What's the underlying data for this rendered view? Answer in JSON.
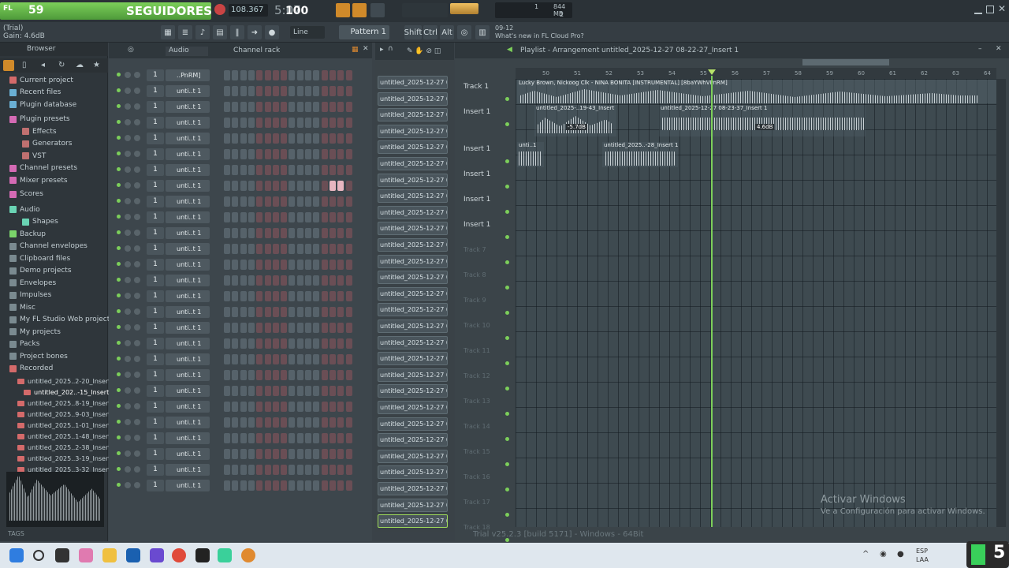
{
  "overlay": {
    "count": "59",
    "label": "SEGUIDORES"
  },
  "transport": {
    "tempo": "108.367",
    "pattern_num": "100",
    "counter": "5:07"
  },
  "cpu": {
    "memory": "844 MB",
    "voices": "1",
    "cpu_n": "2"
  },
  "hint": {
    "date": "09-12",
    "text": "What's new in FL Cloud Pro?"
  },
  "app": {
    "trial": "(Trial)",
    "gain": "Gain: 4.6dB",
    "snap_mode": "Line",
    "pattern": "Pattern 1",
    "mode_shift": "Shift",
    "mode_ctrl": "Ctrl",
    "mode_alt": "Alt"
  },
  "browser": {
    "title": "Browser",
    "items": [
      {
        "label": "Current project",
        "color": "#d46a6a"
      },
      {
        "label": "Recent files",
        "color": "#6ab0d4"
      },
      {
        "label": "Plugin database",
        "color": "#6ab0d4"
      },
      {
        "label": "Plugin presets",
        "color": "#d46ab4"
      },
      {
        "label": "Effects",
        "color": "#c07070"
      },
      {
        "label": "Generators",
        "color": "#c07070"
      },
      {
        "label": "VST",
        "color": "#c07070"
      },
      {
        "label": "Channel presets",
        "color": "#d46ab4"
      },
      {
        "label": "Mixer presets",
        "color": "#d46ab4"
      },
      {
        "label": "Scores",
        "color": "#d46ab4"
      },
      {
        "label": "Audio",
        "color": "#6ad4b4"
      },
      {
        "label": "Shapes",
        "color": "#6ad4b4"
      },
      {
        "label": "Backup",
        "color": "#7ad46a"
      },
      {
        "label": "Channel envelopes",
        "color": "#7a8a90"
      },
      {
        "label": "Clipboard files",
        "color": "#7a8a90"
      },
      {
        "label": "Demo projects",
        "color": "#7a8a90"
      },
      {
        "label": "Envelopes",
        "color": "#7a8a90"
      },
      {
        "label": "Impulses",
        "color": "#7a8a90"
      },
      {
        "label": "Misc",
        "color": "#7a8a90"
      },
      {
        "label": "My FL Studio Web projects",
        "color": "#7a8a90"
      },
      {
        "label": "My projects",
        "color": "#7a8a90"
      },
      {
        "label": "Packs",
        "color": "#7a8a90"
      },
      {
        "label": "Project bones",
        "color": "#7a8a90"
      },
      {
        "label": "Recorded",
        "color": "#d46a6a"
      }
    ],
    "recorded": [
      "untitled_2025..2-20_Insert 1",
      "untitled_202..-15_Insert 1",
      "untitled_2025..8-19_Insert 1",
      "untitled_2025..9-03_Insert 1",
      "untitled_2025..1-01_Insert 1",
      "untitled_2025..1-48_Insert 1",
      "untitled_2025..2-38_Insert 1",
      "untitled_2025..3-19_Insert 1",
      "untitled_2025..3-32_Insert 1"
    ],
    "tags": "TAGS"
  },
  "channel_rack": {
    "title": "Channel rack",
    "filter": "Audio",
    "channels": [
      "..PnRM]",
      "unti..t 1",
      "unti..t 1",
      "unti..t 1",
      "unti..t 1",
      "unti..t 1",
      "unti..t 1",
      "unti..t 1",
      "unti..t 1",
      "unti..t 1",
      "unti..t 1",
      "unti..t 1",
      "unti..t 1",
      "unti..t 1",
      "unti..t 1",
      "unti..t 1",
      "unti..t 1",
      "unti..t 1",
      "unti..t 1",
      "unti..t 1",
      "unti..t 1",
      "unti..t 1",
      "unti..t 1",
      "unti..t 1",
      "unti..t 1",
      "unti..t 1",
      "unti..t 1"
    ],
    "step_no": "1"
  },
  "patterns": [
    "untitled_2025-12-27 07-",
    "untitled_2025-12-27 07-",
    "untitled_2025-12-27 07-",
    "untitled_2025-12-27 07-",
    "untitled_2025-12-27 07-",
    "untitled_2025-12-27 07-",
    "untitled_2025-12-27 07-",
    "untitled_2025-12-27 07-",
    "untitled_2025-12-27 07-",
    "untitled_2025-12-27 07-",
    "untitled_2025-12-27 07-",
    "untitled_2025-12-27 07-",
    "untitled_2025-12-27 07-",
    "untitled_2025-12-27 07-",
    "untitled_2025-12-27 08-",
    "untitled_2025-12-27 08-",
    "untitled_2025-12-27 08-",
    "untitled_2025-12-27 08-",
    "untitled_2025-12-27 08-",
    "untitled_2025-12-27 08-",
    "untitled_2025-12-27 08-",
    "untitled_2025-12-27 08-",
    "untitled_2025-12-27 08-",
    "untitled_2025-12-27 08-",
    "untitled_2025-12-27 08-",
    "untitled_2025-12-27 08-",
    "untitled_2025-12-27 08-",
    "untitled_2025-12-27 08-"
  ],
  "playlist": {
    "title": "Playlist - Arrangement",
    "project": "untitled_2025-12-27 08-22-27_Insert 1",
    "ruler": [
      "50",
      "51",
      "52",
      "53",
      "54",
      "55",
      "56",
      "57",
      "58",
      "59",
      "60",
      "61",
      "62",
      "63",
      "64"
    ],
    "tracks": [
      "Track 1",
      "Insert 1",
      "",
      "Insert 1",
      "Insert 1",
      "Insert 1",
      "Insert 1",
      "Track 7",
      "Track 8",
      "Track 9",
      "Track 10",
      "Track 11",
      "Track 12",
      "Track 13",
      "Track 14",
      "Track 15",
      "Track 16",
      "Track 17",
      "Track 18"
    ],
    "clips": {
      "top": "Lucky Brown, Nickoog Clk - NIÑA BONITA [INSTRUMENTAL] [8baYWhVPnRM]",
      "a": "untitled_2025-..19-43_Insert 1",
      "b": "untitled_2025-12-27 08-23-37_Insert 1",
      "c": "unti..1",
      "d": "untitled_2025..-28_Insert 1",
      "gain_a": "-5.7dB",
      "gain_b": "4.6dB"
    }
  },
  "watermark": {
    "line1": "Activar Windows",
    "line2": "Ve a Configuración para activar Windows."
  },
  "status": "Trial v25.2.3 [build 5171] - Windows - 64Bit",
  "taskbar": {
    "lang": "ESP",
    "layout": "LAA",
    "corner": "5"
  }
}
